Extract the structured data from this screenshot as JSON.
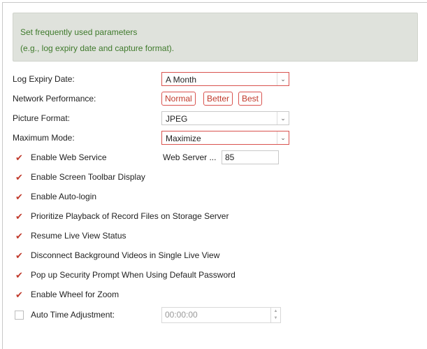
{
  "info": {
    "line1": "Set frequently used parameters",
    "line2": "(e.g., log expiry date and capture format)."
  },
  "fields": {
    "log_expiry": {
      "label": "Log Expiry Date:",
      "value": "A Month"
    },
    "network_performance": {
      "label": "Network Performance:",
      "options": [
        "Normal",
        "Better",
        "Best"
      ]
    },
    "picture_format": {
      "label": "Picture Format:",
      "value": "JPEG"
    },
    "maximum_mode": {
      "label": "Maximum Mode:",
      "value": "Maximize"
    }
  },
  "checkboxes": [
    {
      "label": "Enable Web Service",
      "checked": true
    },
    {
      "label": "Enable Screen Toolbar Display",
      "checked": true
    },
    {
      "label": "Enable Auto-login",
      "checked": true
    },
    {
      "label": "Prioritize Playback of Record Files on Storage Server",
      "checked": true
    },
    {
      "label": "Resume Live View Status",
      "checked": true
    },
    {
      "label": "Disconnect Background Videos in Single Live View",
      "checked": true
    },
    {
      "label": "Pop up Security Prompt When Using Default Password",
      "checked": true
    },
    {
      "label": "Enable Wheel for Zoom",
      "checked": true
    },
    {
      "label": "Auto Time Adjustment:",
      "checked": false
    }
  ],
  "web_server": {
    "label": "Web Server ...",
    "port": "85"
  },
  "auto_time": {
    "value": "00:00:00"
  },
  "icons": {
    "checkmark": "checkmark-icon",
    "dropdown": "chevron-down-icon",
    "spin_up": "caret-up-icon",
    "spin_down": "caret-down-icon"
  },
  "colors": {
    "accent": "#d9534f",
    "info_bg": "#dfe2dc",
    "info_text": "#3f7a2c"
  }
}
